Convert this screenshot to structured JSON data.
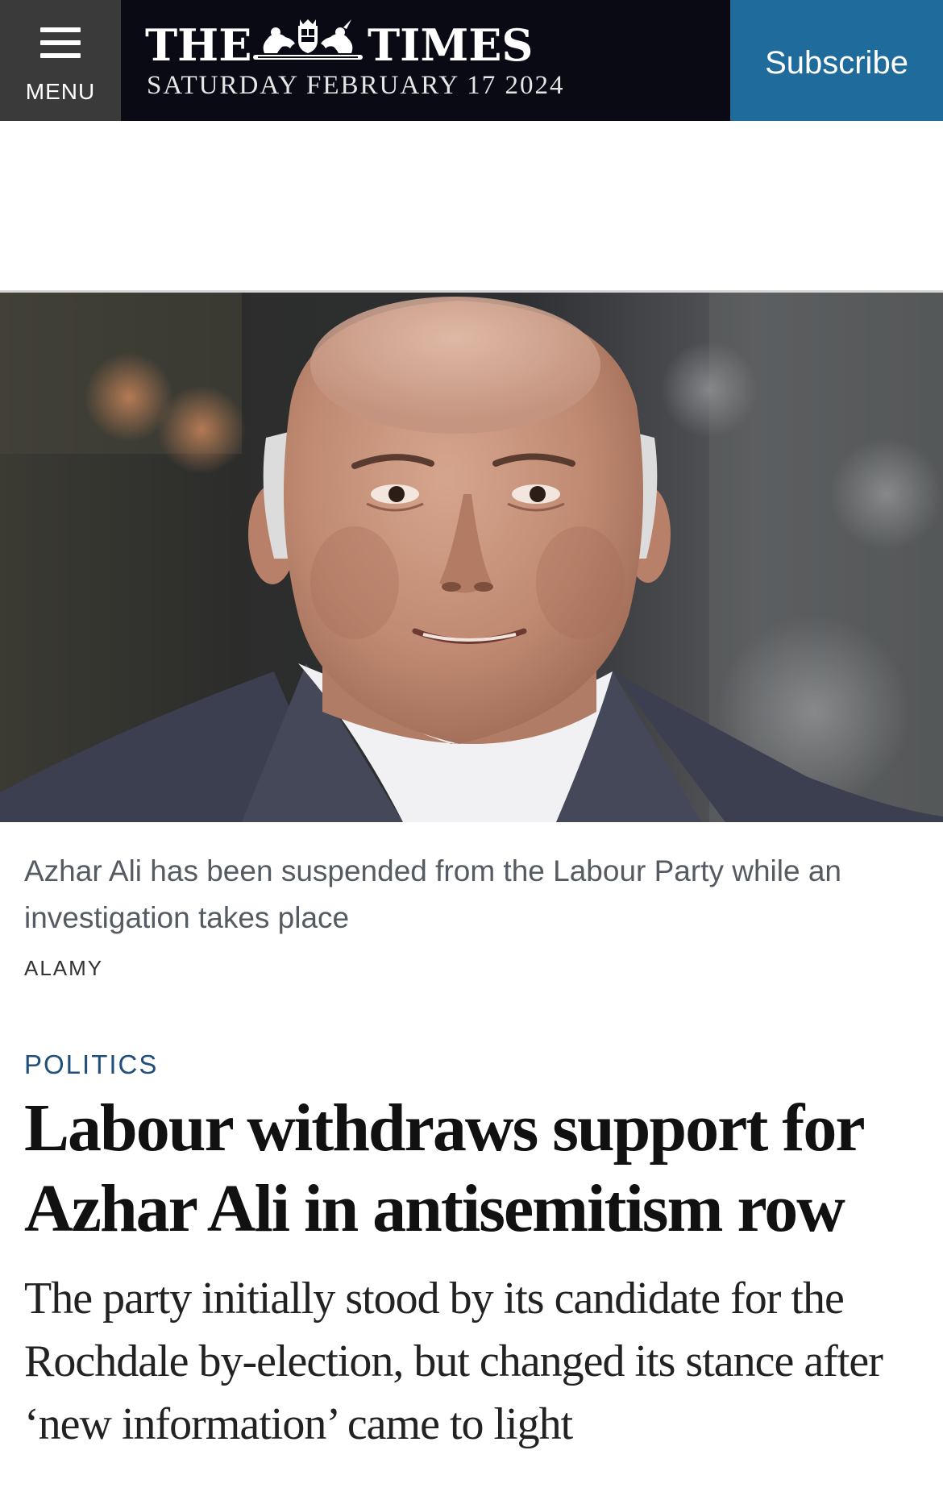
{
  "header": {
    "menu_label": "MENU",
    "masthead_left": "THE",
    "masthead_right": "TIMES",
    "dateline": "SATURDAY FEBRUARY 17 2024",
    "subscribe_label": "Subscribe",
    "colors": {
      "bar": "#0a0a14",
      "menu": "#3a3a3a",
      "subscribe": "#1f6b9c"
    }
  },
  "hero": {
    "icon": "portrait-photo"
  },
  "caption": {
    "text": "Azhar Ali has been suspended from the Labour Party while an investigation takes place",
    "credit": "ALAMY"
  },
  "article": {
    "section": "POLITICS",
    "headline": "Labour withdraws support for Azhar Ali in antisemitism row",
    "standfirst": "The party initially stood by its candidate for the Rochdale by-election, but changed its stance after ‘new information’ came to light"
  }
}
